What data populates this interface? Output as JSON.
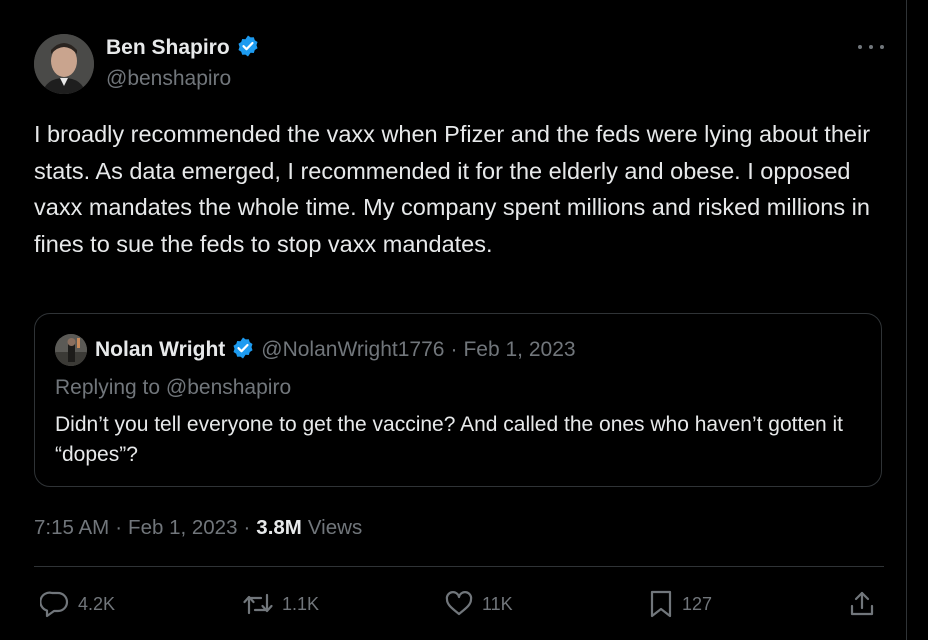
{
  "author": {
    "name": "Ben Shapiro",
    "handle": "@benshapiro",
    "verified": true
  },
  "tweet": {
    "text": "I broadly recommended the vaxx when Pfizer and the feds were lying about their stats. As data emerged, I recommended it for the elderly and obese. I opposed vaxx mandates the whole time. My company spent millions and risked millions in fines to sue the feds to stop vaxx mandates.",
    "time": "7:15 AM",
    "separator": "·",
    "date": "Feb 1, 2023",
    "views_count": "3.8M",
    "views_label": "Views"
  },
  "quote": {
    "name": "Nolan Wright",
    "handle": "@NolanWright1776",
    "separator": "·",
    "date": "Feb 1, 2023",
    "replying_to": "Replying to @benshapiro",
    "text": "Didn’t you tell everyone to get the vaccine? And called the ones who haven’t gotten it “dopes”?",
    "verified": true
  },
  "actions": {
    "replies": "4.2K",
    "reposts": "1.1K",
    "likes": "11K",
    "bookmarks": "127"
  },
  "colors": {
    "background": "#000000",
    "primary_text": "#e7e9ea",
    "secondary_text": "#71767b",
    "verified_badge": "#1d9bf0",
    "border": "#2f3336"
  }
}
